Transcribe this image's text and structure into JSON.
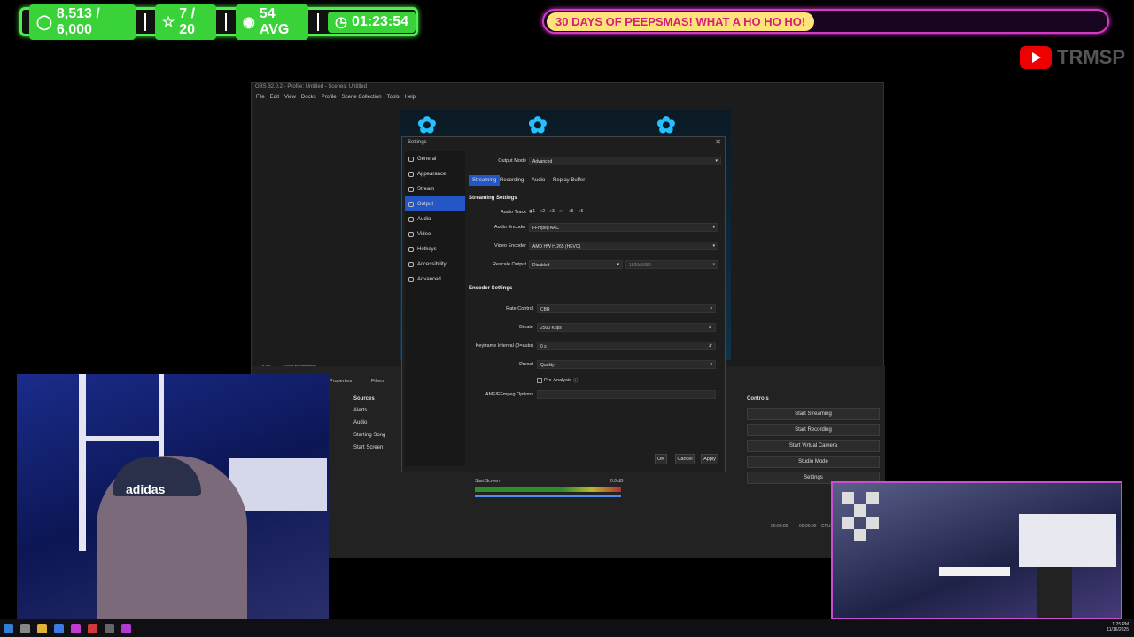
{
  "overlay": {
    "stats": [
      {
        "icon": "person-icon",
        "value": "8,513 / 6,000"
      },
      {
        "icon": "star-icon",
        "value": "7 / 20"
      },
      {
        "icon": "eye-icon",
        "value": "54 AVG"
      },
      {
        "icon": "timer-icon",
        "value": "01:23:54"
      }
    ],
    "marquee": "30 DAYS OF PEEPSMAS! WHAT A HO HO HO!",
    "brand": "TRMSP",
    "colors": {
      "stats_border": "#4df04d",
      "marquee_border": "#d838c9",
      "youtube": "#ee0000"
    }
  },
  "obs": {
    "title": "OBS 32.0.2 - Profile: Untitled - Scenes: Untitled",
    "menu": [
      "File",
      "Edit",
      "View",
      "Docks",
      "Profile",
      "Scene Collection",
      "Tools",
      "Help"
    ],
    "zoom": "52%",
    "scale_mode": "Scale to Window",
    "tabs": {
      "properties": "Properties",
      "filters": "Filters"
    },
    "sources_header": "Sources",
    "sources": [
      "Alerts",
      "Audio",
      "Starting Song",
      "Start Screen"
    ],
    "mixer_source": "Start Screen",
    "mixer_level": "0.0 dB",
    "controls_header": "Controls",
    "controls": [
      "Start Streaming",
      "Start Recording",
      "Start Virtual Camera",
      "Studio Mode",
      "Settings"
    ],
    "status_time_1": "00:00:00",
    "status_time_2": "00:00:00",
    "cpu": "CPU"
  },
  "settings": {
    "title": "Settings",
    "sidebar": [
      "General",
      "Appearance",
      "Stream",
      "Output",
      "Audio",
      "Video",
      "Hotkeys",
      "Accessibility",
      "Advanced"
    ],
    "active_item": "Output",
    "output_mode_label": "Output Mode",
    "output_mode": "Advanced",
    "tabs": [
      "Streaming",
      "Recording",
      "Audio",
      "Replay Buffer"
    ],
    "streaming_settings": "Streaming Settings",
    "audio_track_label": "Audio Track",
    "audio_tracks": [
      "1",
      "2",
      "3",
      "4",
      "5",
      "6"
    ],
    "audio_encoder_label": "Audio Encoder",
    "audio_encoder": "FFmpeg AAC",
    "video_encoder_label": "Video Encoder",
    "video_encoder": "AMD HW H.265 (HEVC)",
    "rescale_label": "Rescale Output",
    "rescale": "Disabled",
    "rescale_res": "1920x1080",
    "encoder_settings": "Encoder Settings",
    "rate_control_label": "Rate Control",
    "rate_control": "CBR",
    "bitrate_label": "Bitrate",
    "bitrate": "2500 Kbps",
    "keyframe_label": "Keyframe Interval (0=auto)",
    "keyframe": "0 s",
    "preset_label": "Preset",
    "preset": "Quality",
    "pre_analysis": "Pre-Analysis",
    "amf_label": "AMF/FFmpeg Options",
    "ok": "OK",
    "cancel": "Cancel",
    "apply": "Apply"
  },
  "webcam": {
    "cap_text": "adidas"
  },
  "taskbar": {
    "time": "1:25 PM",
    "date": "11/16/2025"
  }
}
